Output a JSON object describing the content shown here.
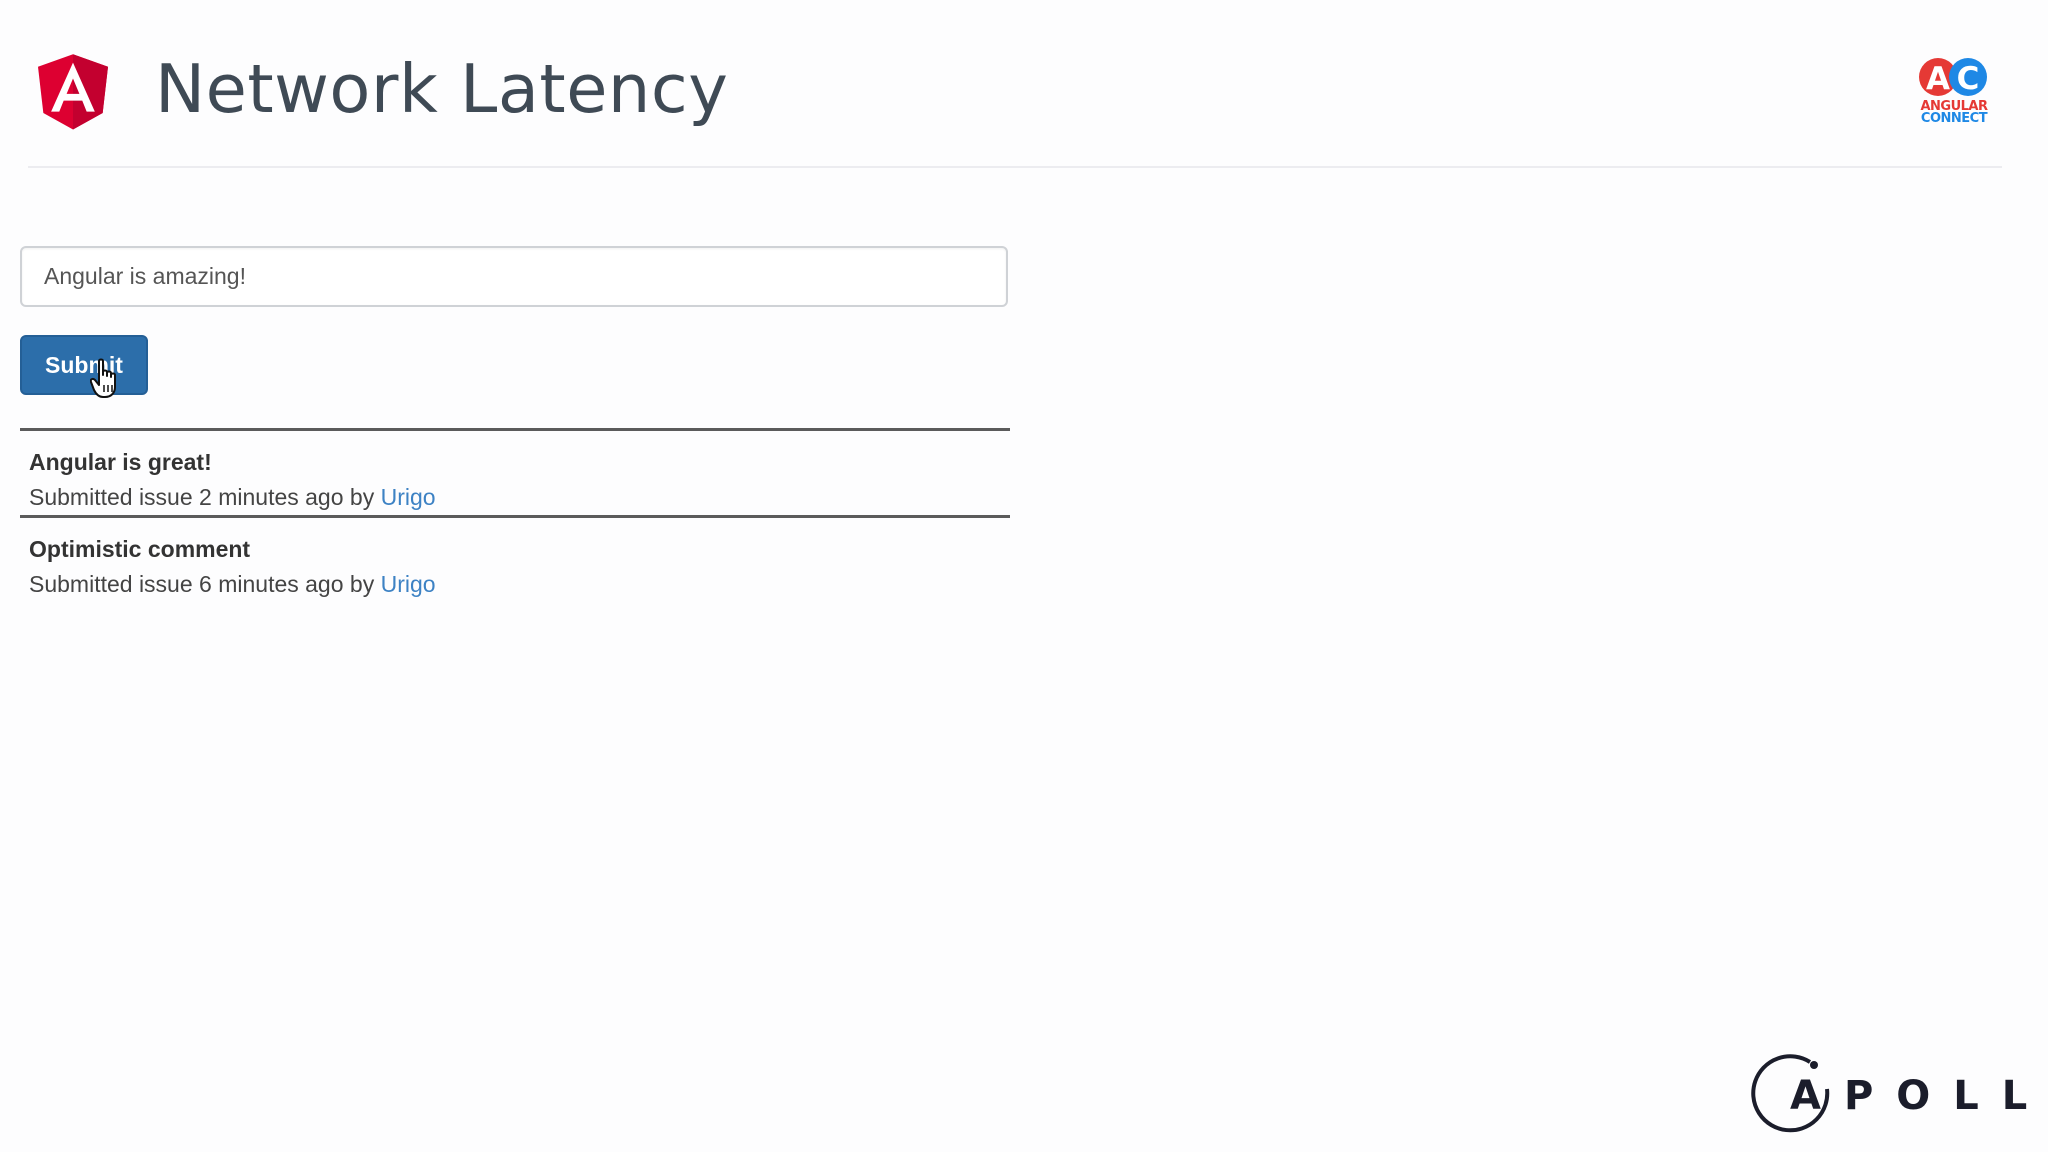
{
  "header": {
    "title": "Network Latency",
    "logo_icon": "angular-logo-icon",
    "conference_logo": {
      "icon": "angular-connect-logo-icon",
      "letters": [
        "A",
        "C"
      ],
      "line1": "ANGULAR",
      "line2": "CONNECT"
    }
  },
  "form": {
    "input_value": "Angular is amazing!",
    "submit_label": "Submit"
  },
  "comments": [
    {
      "title": "Angular is great!",
      "meta_prefix": "Submitted issue 2 minutes ago by ",
      "author": "Urigo"
    },
    {
      "title": "Optimistic comment",
      "meta_prefix": "Submitted issue 6 minutes ago by ",
      "author": "Urigo"
    }
  ],
  "footer": {
    "brand": "APOLLO",
    "logo_icon": "apollo-logo-icon"
  },
  "colors": {
    "angular_red": "#dd0031",
    "angular_dark_red": "#c3002f",
    "title": "#3f4a55",
    "button": "#2c6eaa",
    "link": "#3d82c4",
    "connect_blue": "#1e88e5",
    "apollo": "#1b1d2b"
  }
}
